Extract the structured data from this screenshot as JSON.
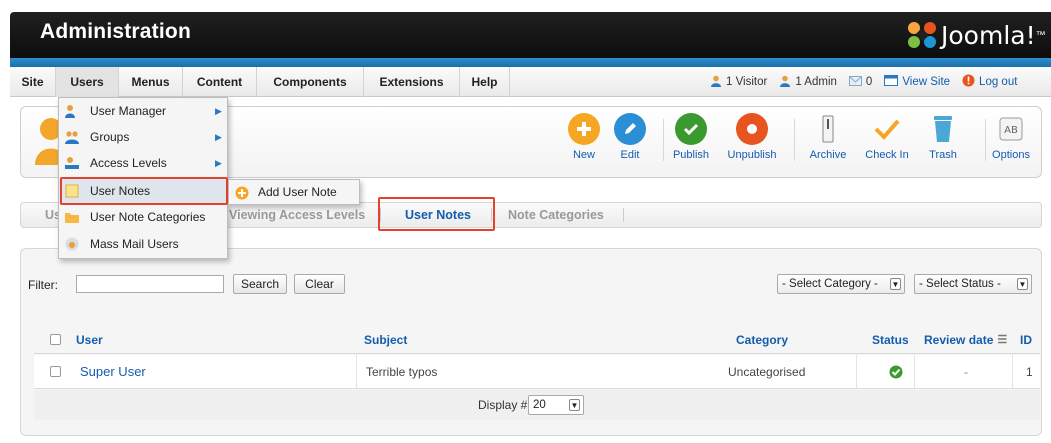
{
  "header": {
    "title": "Administration",
    "logo_text": "Joomla!",
    "logo_mark": "™"
  },
  "menubar": {
    "items": [
      "Site",
      "Users",
      "Menus",
      "Content",
      "Components",
      "Extensions",
      "Help"
    ],
    "active": "Users",
    "status": {
      "visitors": "1 Visitor",
      "admins": "1 Admin",
      "messages": "0",
      "view_site": "View Site",
      "logout": "Log out"
    }
  },
  "users_menu": {
    "items": [
      {
        "label": "User Manager",
        "icon": "user-manager-icon",
        "submenu": true
      },
      {
        "label": "Groups",
        "icon": "groups-icon",
        "submenu": true
      },
      {
        "label": "Access Levels",
        "icon": "access-levels-icon",
        "submenu": true
      },
      {
        "label": "User Notes",
        "icon": "user-notes-icon",
        "submenu": false,
        "highlighted": true
      },
      {
        "label": "User Note Categories",
        "icon": "note-categories-icon",
        "submenu": false
      },
      {
        "label": "Mass Mail Users",
        "icon": "mass-mail-icon",
        "submenu": false
      }
    ],
    "submenu_user_notes": {
      "label": "Add User Note"
    }
  },
  "toolbar": {
    "buttons": [
      {
        "label": "New",
        "color": "#f5a623"
      },
      {
        "label": "Edit",
        "color": "#2a8fd4"
      },
      {
        "label": "Publish",
        "color": "#3a9a2f"
      },
      {
        "label": "Unpublish",
        "color": "#e8541f"
      },
      {
        "label": "Archive",
        "color": "#777777"
      },
      {
        "label": "Check In",
        "color": "#f5a623"
      },
      {
        "label": "Trash",
        "color": "#4aa8d8"
      },
      {
        "label": "Options",
        "color": "#888888"
      }
    ]
  },
  "subnav": {
    "partial_first": "Us",
    "tabs": [
      "Viewing Access Levels",
      "User Notes",
      "Note Categories"
    ],
    "current": "User Notes"
  },
  "filter": {
    "label": "Filter:",
    "value": "",
    "search_label": "Search",
    "clear_label": "Clear",
    "category_select": "- Select Category -",
    "status_select": "- Select Status -"
  },
  "table": {
    "headers": {
      "user": "User",
      "subject": "Subject",
      "category": "Category",
      "status": "Status",
      "review_date": "Review date",
      "id": "ID"
    },
    "rows": [
      {
        "user": "Super User",
        "subject": "Terrible typos",
        "category": "Uncategorised",
        "status": "published",
        "review_date": "-",
        "id": "1"
      }
    ],
    "display_label": "Display #",
    "display_value": "20"
  },
  "colors": {
    "accent": "#135cae",
    "highlight": "#e2432e",
    "stripe": "#2c8fcf"
  }
}
